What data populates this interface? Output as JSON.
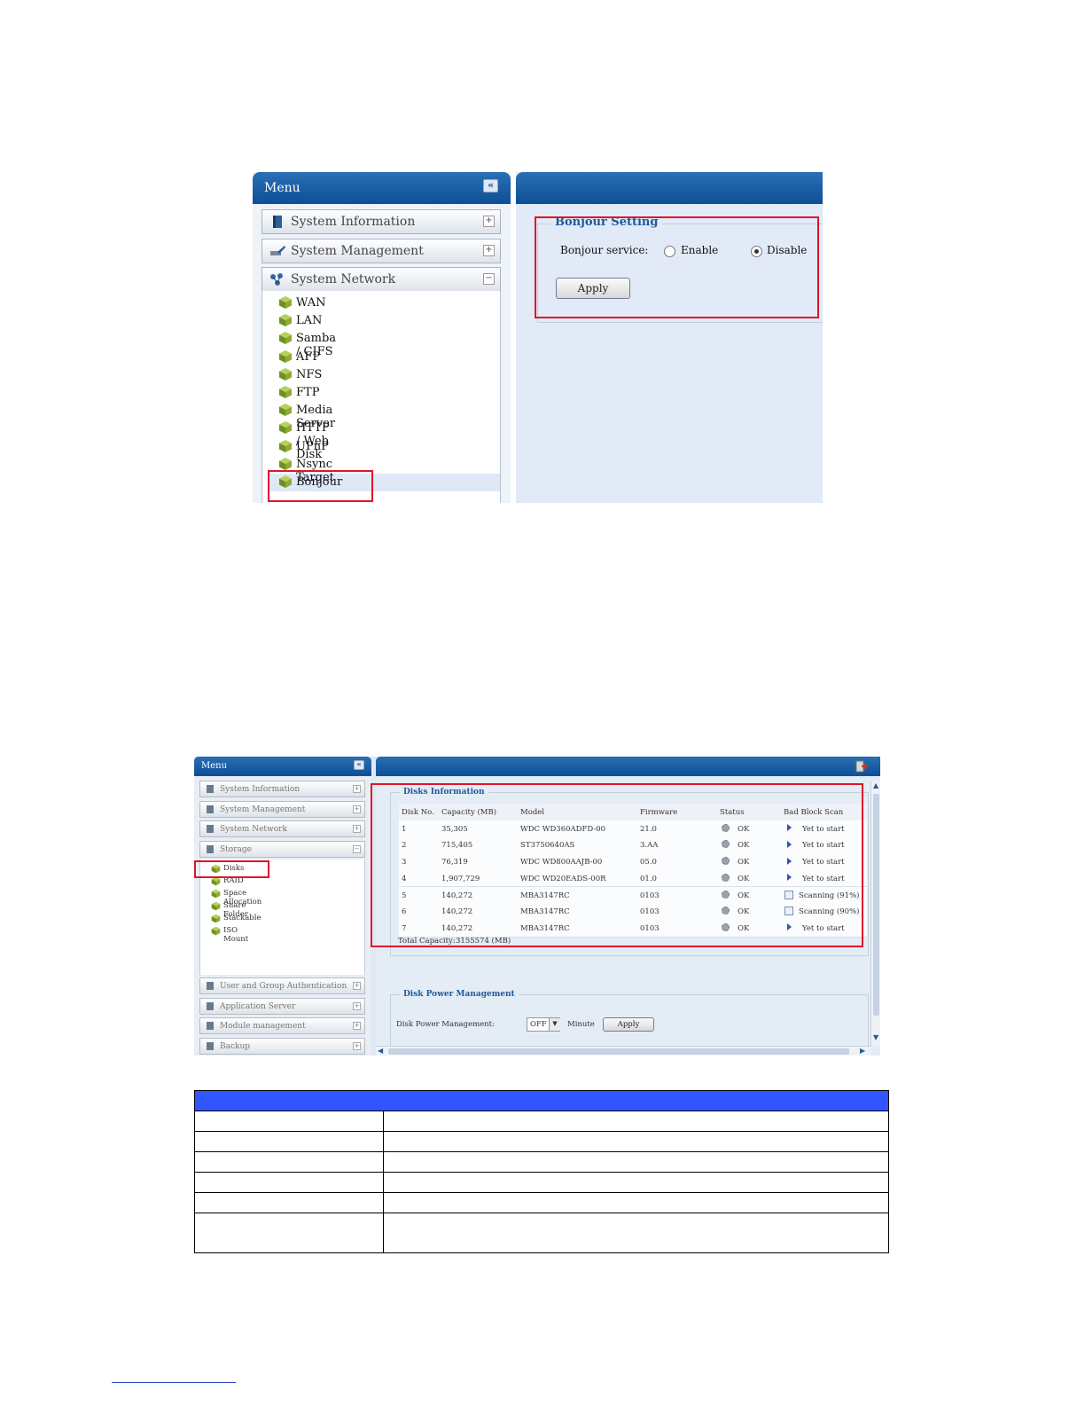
{
  "shot1": {
    "menu": {
      "title": "Menu",
      "collapse": "«",
      "sections": [
        {
          "label": "System Information",
          "toggle": "+"
        },
        {
          "label": "System Management",
          "toggle": "+"
        },
        {
          "label": "System Network",
          "toggle": "−"
        }
      ],
      "items": [
        "WAN",
        "LAN",
        "Samba / CIFS",
        "AFP",
        "NFS",
        "FTP",
        "Media Server",
        "HTTP / Web Disk",
        "UPnP",
        "Nsync Target",
        "Bonjour"
      ],
      "selected": "Bonjour"
    },
    "bonjour": {
      "legend": "Bonjour Setting",
      "service_label": "Bonjour service:",
      "enable_label": "Enable",
      "disable_label": "Disable",
      "selected": "Disable",
      "apply_label": "Apply"
    }
  },
  "shot2": {
    "menu": {
      "title": "Menu",
      "collapse": "«",
      "sections_top": [
        {
          "label": "System Information",
          "toggle": "+"
        },
        {
          "label": "System Management",
          "toggle": "+"
        },
        {
          "label": "System Network",
          "toggle": "+"
        },
        {
          "label": "Storage",
          "toggle": "−"
        }
      ],
      "items": [
        "Disks",
        "RAID",
        "Space Allocation",
        "Share Folder",
        "Stackable",
        "ISO Mount"
      ],
      "sections_bottom": [
        {
          "label": "User and Group Authentication",
          "toggle": "+"
        },
        {
          "label": "Application Server",
          "toggle": "+"
        },
        {
          "label": "Module management",
          "toggle": "+"
        },
        {
          "label": "Backup",
          "toggle": "+"
        }
      ]
    },
    "disks": {
      "legend": "Disks Information",
      "columns": [
        "Disk No.",
        "Capacity (MB)",
        "Model",
        "Firmware",
        "Status",
        "Bad Block Scan"
      ],
      "rows": [
        {
          "no": "1",
          "capacity": "35,305",
          "model": "WDC WD360ADFD-00",
          "firmware": "21.0",
          "status": "OK",
          "scan": "Yet to start",
          "scan_icon": "play"
        },
        {
          "no": "2",
          "capacity": "715,405",
          "model": "ST3750640AS",
          "firmware": "3.AA",
          "status": "OK",
          "scan": "Yet to start",
          "scan_icon": "play"
        },
        {
          "no": "3",
          "capacity": "76,319",
          "model": "WDC WD800AAJB-00",
          "firmware": "05.0",
          "status": "OK",
          "scan": "Yet to start",
          "scan_icon": "play"
        },
        {
          "no": "4",
          "capacity": "1,907,729",
          "model": "WDC WD20EADS-00R",
          "firmware": "01.0",
          "status": "OK",
          "scan": "Yet to start",
          "scan_icon": "play"
        },
        {
          "no": "5",
          "capacity": "140,272",
          "model": "MBA3147RC",
          "firmware": "0103",
          "status": "OK",
          "scan": "Scanning (91%)",
          "scan_icon": "checkbox"
        },
        {
          "no": "6",
          "capacity": "140,272",
          "model": "MBA3147RC",
          "firmware": "0103",
          "status": "OK",
          "scan": "Scanning (90%)",
          "scan_icon": "checkbox"
        },
        {
          "no": "7",
          "capacity": "140,272",
          "model": "MBA3147RC",
          "firmware": "0103",
          "status": "OK",
          "scan": "Yet to start",
          "scan_icon": "play"
        }
      ],
      "total_label": "Total Capacity:",
      "total_value": "3155574 (MB)"
    },
    "power": {
      "legend": "Disk Power Management",
      "label": "Disk Power Management:",
      "value": "OFF",
      "unit": "Minute",
      "apply_label": "Apply"
    }
  },
  "colors": {
    "header_blue": "#0d4f96",
    "highlight_red": "#e0142a",
    "table_header": "#3355ff"
  }
}
